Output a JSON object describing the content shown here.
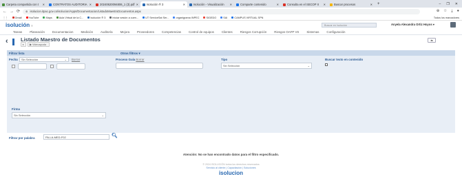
{
  "browser": {
    "tabs": [
      {
        "label": "Carpeta compartida con t",
        "color": "#4a8f3c",
        "active": false
      },
      {
        "label": "CONTRATOS AUDITORIA",
        "color": "#1a73e8",
        "active": false
      },
      {
        "label": "20240620094806_1 (3).pdf",
        "color": "#d93025",
        "active": false
      },
      {
        "label": "Isolución ® 3",
        "color": "#2767b0",
        "active": true
      },
      {
        "label": "Isolución - Visualización",
        "color": "#2767b0",
        "active": false
      },
      {
        "label": "Comparte contenido",
        "color": "#1a73e8",
        "active": false
      },
      {
        "label": "Consulta en el SECOP II",
        "color": "#d93025",
        "active": false
      },
      {
        "label": "Buscar procesos",
        "color": "#f4b400",
        "active": false
      }
    ],
    "new_tab": "+",
    "url": "isolucion.itpac.gov.co/isolucion/Apps/Documentacion/ListadoMaestroDocumentos.aspx",
    "bookmarks": [
      {
        "label": "Gmail",
        "color": "#d93025"
      },
      {
        "label": "YouTube",
        "color": "#ff0000"
      },
      {
        "label": "Maps",
        "color": "#34a853"
      },
      {
        "label": "Aula Virtual de la C...",
        "color": "#4a8f3c"
      },
      {
        "label": "Isolución ® 3",
        "color": "#2767b0"
      },
      {
        "label": "Iniciar sesión a cuen...",
        "color": "#5f6368"
      },
      {
        "label": "UT ServiceSat Ser...",
        "color": "#1a73e8"
      },
      {
        "label": "organigrama INPEC",
        "color": "#4285f4"
      },
      {
        "label": "SIGEDO",
        "color": "#ea4335"
      },
      {
        "label": "SAI",
        "color": "#4285f4"
      },
      {
        "label": "CAMPUS VIRTUAL SPN",
        "color": "#1a73e8"
      }
    ],
    "all_bookmarks": "Todos los marcadores"
  },
  "app": {
    "logo": "isolución",
    "logo_sub": "®",
    "search_placeholder": "Buscar en Isolución",
    "user_name": "Anyela Alexandra Ortiz Hoyos ▾"
  },
  "menu": [
    "Tareas",
    "Planeación",
    "Documentacion",
    "Medición",
    "Auditoría",
    "Mejora",
    "Proveedores",
    "Competencias",
    "Control de equipos",
    "Clientes",
    "Riesgos Corrupción",
    "Riesgos OAFP VS",
    "Sistemas",
    "Configuración"
  ],
  "page": {
    "title": "Listado Maestro de Documentos",
    "btn_small": "◐",
    "btn_video": "▶ Videoayuda",
    "right_btn": "⇆"
  },
  "filters": {
    "header_left": "Filtrar lista",
    "header_right": "Otros filtros ▾",
    "fecha_label": "Fecha",
    "fecha_select": "Sin Selección",
    "fecha_clear": "Borrar",
    "proceso_label": "Proceso Guía",
    "proceso_clear": "Borrar",
    "tipo_label": "Tipo",
    "tipo_select": "Sin Selección",
    "buscar_label": "Buscar texto en contenido",
    "firma_label": "Firma",
    "firma_select": "Sin Selección",
    "palabra_label": "Filtrar por palabra",
    "palabra_value": "PA-LA-MED-F02"
  },
  "results": {
    "message": "Atención: No se han encontrado datos para el filtro especificado."
  },
  "footer": {
    "line1": "© 2024 ISOLUCIÓN todos los derechos reservados",
    "links": "Servicio al cliente | Capacitación | Soluciones",
    "logo": "isolucion"
  }
}
